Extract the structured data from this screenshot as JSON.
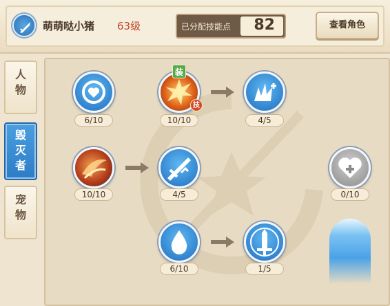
{
  "header": {
    "class_icon": "destroyer-blade-icon",
    "player_name": "萌萌哒小猪",
    "player_level": "63级",
    "points_label": "已分配技能点",
    "points_value": "82",
    "view_role_label": "查看角色"
  },
  "tabs": [
    {
      "label_1": "人",
      "label_2": "物",
      "active": false
    },
    {
      "label_1": "毁",
      "label_2": "灭",
      "label_3": "者",
      "active": true
    },
    {
      "label_1": "宠",
      "label_2": "物",
      "active": false
    }
  ],
  "skills": {
    "heart_shield": {
      "icon": "heart-shield-icon",
      "count": "6/10"
    },
    "explosion": {
      "icon": "explosion-icon",
      "count": "10/10",
      "equip_tag": "装",
      "skill_tag": "技"
    },
    "spark_strike": {
      "icon": "spark-strike-icon",
      "count": "4/5"
    },
    "flame_slash": {
      "icon": "flame-slash-icon",
      "count": "10/10"
    },
    "blade_strike": {
      "icon": "blade-strike-icon",
      "count": "4/5"
    },
    "heal_heart": {
      "icon": "heal-heart-icon",
      "count": "0/10"
    },
    "water_drop": {
      "icon": "water-drop-icon",
      "count": "6/10"
    },
    "sword_emblem": {
      "icon": "sword-emblem-icon",
      "count": "1/5"
    },
    "light_beam": {
      "icon": "light-beam-icon"
    }
  },
  "colors": {
    "accent_blue": "#2d7cc6",
    "level_red": "#c0462a",
    "panel_bg": "#e7dbc3"
  }
}
